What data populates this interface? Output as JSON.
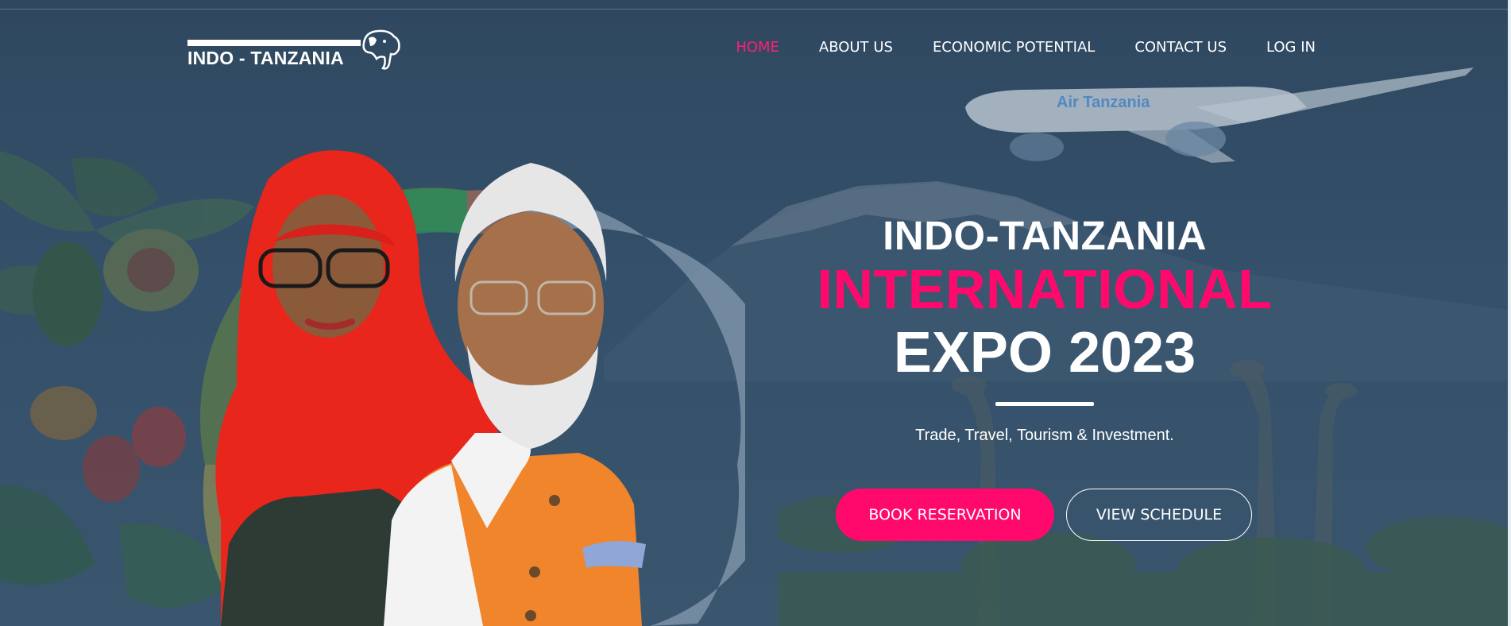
{
  "brand": {
    "logo_text": "INDO - TANZANIA"
  },
  "nav": {
    "items": [
      {
        "label": "HOME",
        "active": true
      },
      {
        "label": "ABOUT US",
        "active": false
      },
      {
        "label": "ECONOMIC POTENTIAL",
        "active": false
      },
      {
        "label": "CONTACT US",
        "active": false
      },
      {
        "label": "LOG IN",
        "active": false
      }
    ]
  },
  "hero": {
    "line1": "INDO-TANZANIA",
    "line2": "INTERNATIONAL",
    "line3": "EXPO 2023",
    "tagline": "Trade, Travel, Tourism & Investment.",
    "primary_button": "BOOK RESERVATION",
    "secondary_button": "VIEW SCHEDULE"
  },
  "plane_livery": "Air Tanzania",
  "colors": {
    "accent": "#ff0a6c",
    "background": "#314a63",
    "text": "#ffffff"
  }
}
